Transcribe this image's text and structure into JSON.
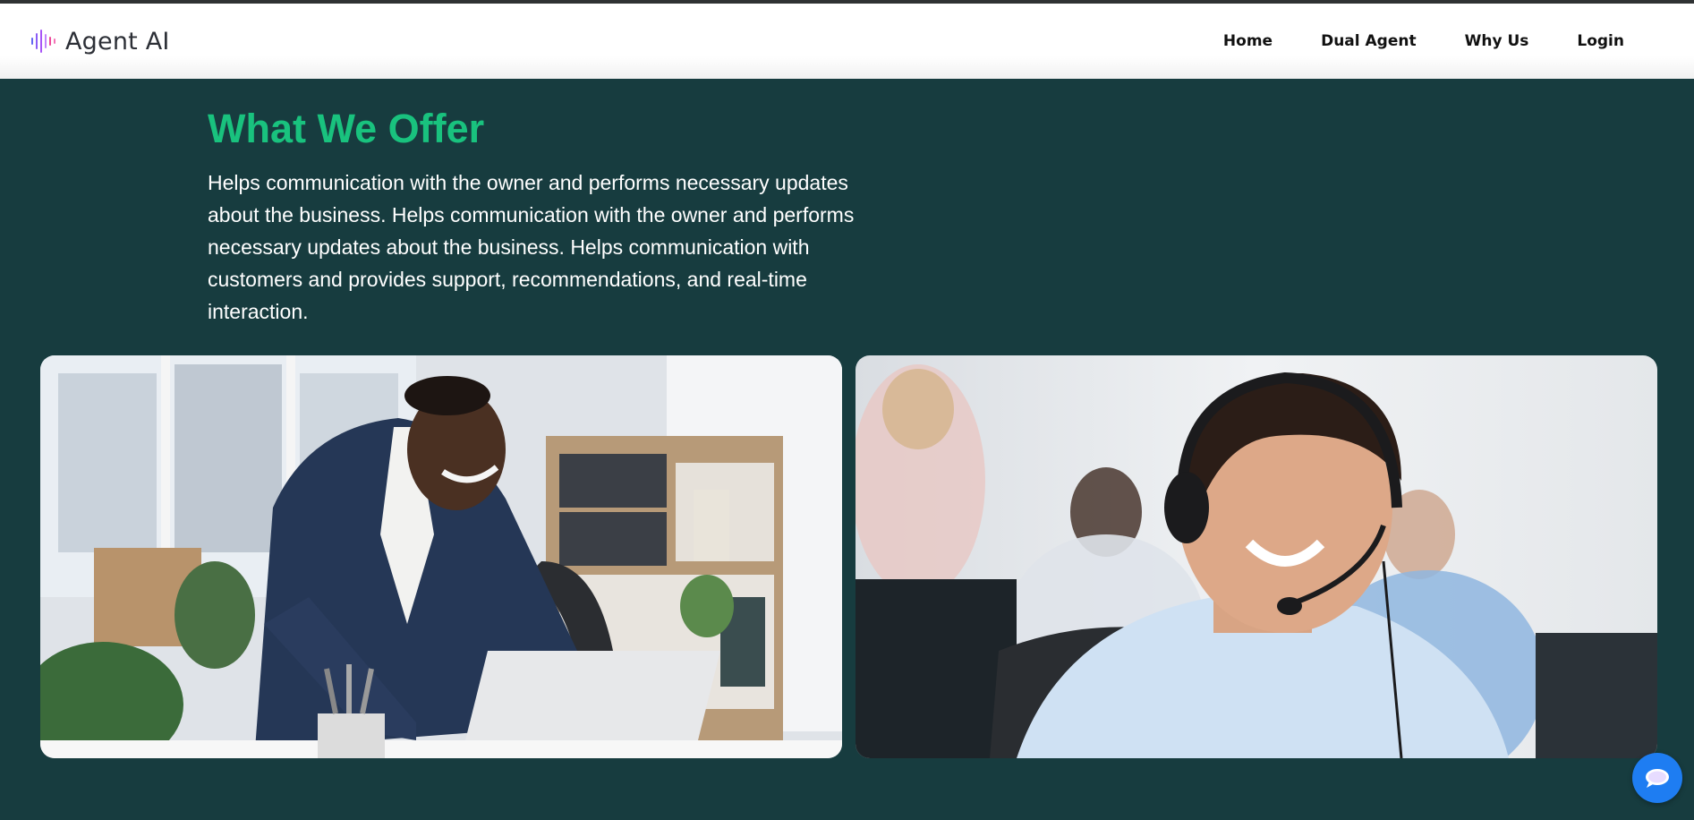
{
  "brand": {
    "name": "Agent AI",
    "logo_icon": "sound-wave-icon",
    "logo_colors": [
      "#8b5cf6",
      "#a855f7",
      "#ec4899",
      "#6366f1"
    ]
  },
  "nav": {
    "items": [
      {
        "label": "Home"
      },
      {
        "label": "Dual Agent"
      },
      {
        "label": "Why Us"
      },
      {
        "label": "Login"
      }
    ]
  },
  "section": {
    "title": "What We Offer",
    "description": "Helps communication with the owner and performs necessary updates about the business. Helps communication with the owner and performs necessary updates about the business. Helps communication with customers and provides support, recommendations, and real-time interaction."
  },
  "images": [
    {
      "subject": "businessman-at-laptop-photo"
    },
    {
      "subject": "call-center-agent-headset-photo"
    }
  ],
  "chat_widget": {
    "icon": "chat-bubble-icon",
    "color": "#1e7df2"
  },
  "colors": {
    "page_background": "#173c3f",
    "accent_green": "#19c27e",
    "nav_text": "#111111"
  }
}
